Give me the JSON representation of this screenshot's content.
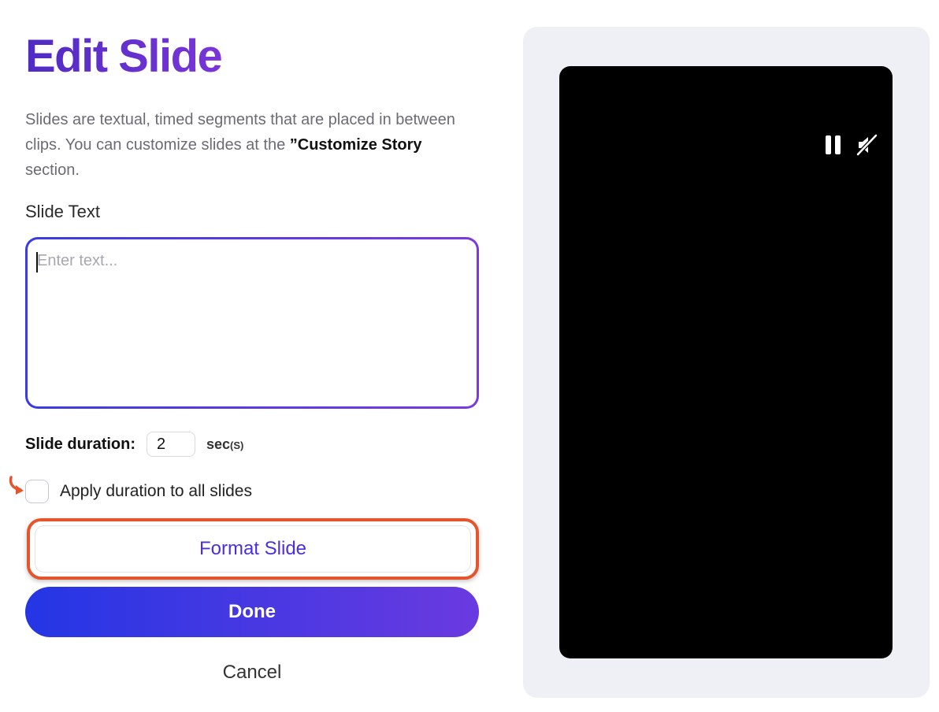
{
  "page": {
    "title": "Edit Slide",
    "description_part1": "Slides are textual, timed segments that are placed in between clips. You can customize slides at the ",
    "description_strong": "”Customize Story",
    "description_part2": " section."
  },
  "slide_text": {
    "label": "Slide Text",
    "value": "",
    "placeholder": "Enter text..."
  },
  "duration": {
    "label": "Slide duration:",
    "value": "2",
    "unit_main": "sec",
    "unit_suffix": "(S)"
  },
  "apply_all": {
    "label": "Apply duration to all slides",
    "checked": false
  },
  "buttons": {
    "format": "Format Slide",
    "done": "Done",
    "cancel": "Cancel"
  },
  "preview": {
    "controls": [
      "pause-icon",
      "mute-icon"
    ]
  },
  "colors": {
    "accent_purple": "#5a2fd0",
    "gradient_start": "#2436e4",
    "gradient_end": "#6a3ae0",
    "highlight_orange": "#e5552d",
    "preview_bg": "#eff0f5"
  }
}
